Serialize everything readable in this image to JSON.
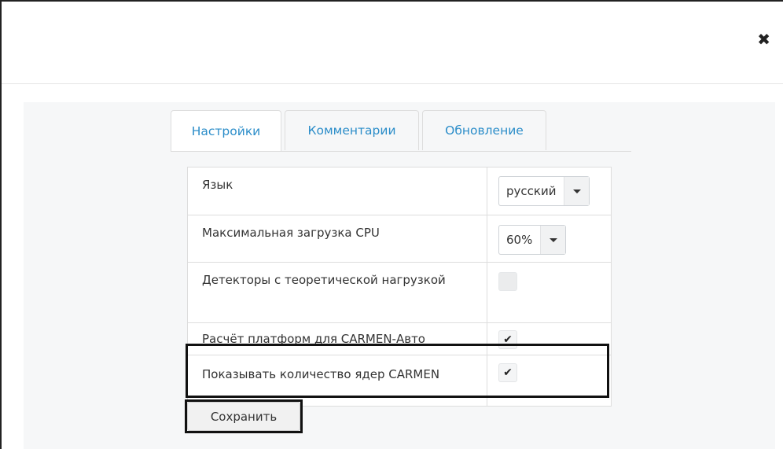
{
  "dialog": {
    "close_symbol": "✖"
  },
  "tabs": [
    {
      "label": "Настройки",
      "active": true
    },
    {
      "label": "Комментарии",
      "active": false
    },
    {
      "label": "Обновление",
      "active": false
    }
  ],
  "settings": {
    "language": {
      "label": "Язык",
      "value": "русский"
    },
    "cpu": {
      "label": "Максимальная загрузка CPU",
      "value": "60%"
    },
    "detectors": {
      "label": "Детекторы с теоретической нагрузкой",
      "checked": false
    },
    "platforms": {
      "label": "Расчёт платформ для CARMEN-Авто",
      "checked": true
    },
    "cores": {
      "label": "Показывать количество ядер CARMEN",
      "checked": true
    }
  },
  "check_symbol": "✔",
  "save_button": {
    "label": "Сохранить"
  }
}
